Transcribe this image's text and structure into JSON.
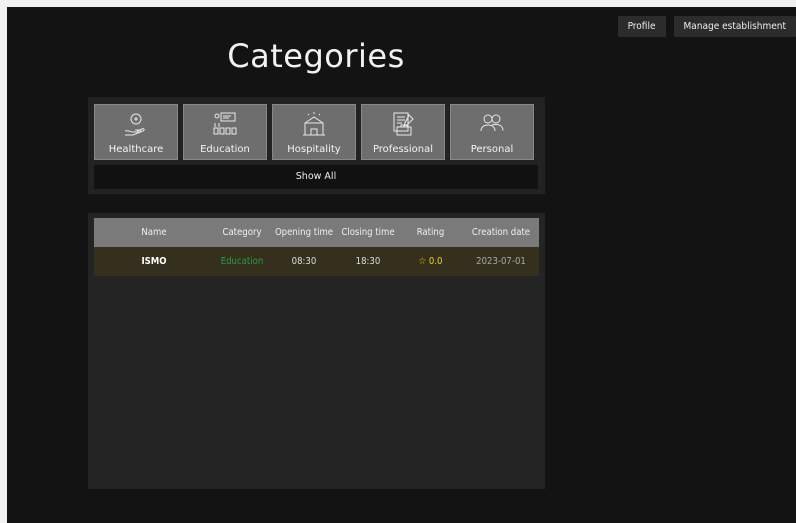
{
  "nav": {
    "profile": "Profile",
    "manage": "Manage establishment"
  },
  "page": {
    "title": "Categories"
  },
  "categories": [
    {
      "label": "Healthcare",
      "icon": "healthcare-icon"
    },
    {
      "label": "Education",
      "icon": "education-icon"
    },
    {
      "label": "Hospitality",
      "icon": "hospitality-icon"
    },
    {
      "label": "Professional",
      "icon": "professional-icon"
    },
    {
      "label": "Personal",
      "icon": "personal-icon"
    }
  ],
  "show_all": "Show All",
  "table": {
    "columns": [
      "Name",
      "Category",
      "Opening time",
      "Closing time",
      "Rating",
      "Creation date"
    ],
    "rows": [
      {
        "name": "ISMO",
        "category": "Education",
        "opening": "08:30",
        "closing": "18:30",
        "rating": "0.0",
        "created": "2023-07-01"
      }
    ]
  },
  "colors": {
    "category_text": "#2e9a46",
    "rating": "#f3d21f",
    "row_bg": "#34301d"
  }
}
